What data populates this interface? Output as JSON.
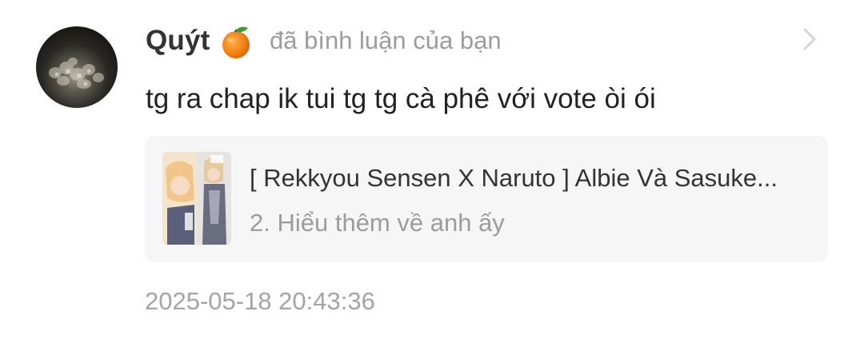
{
  "notification": {
    "username": "Quýt",
    "badge_icon": "orange-emoji-icon",
    "action_text": "đã bình luận của bạn",
    "comment": "tg ra chap ik tui tg tg cà phê với vote òi ói",
    "story": {
      "title": "[ Rekkyou Sensen X Naruto ] Albie Và Sasuke...",
      "chapter": "2. Hiểu thêm về anh ấy"
    },
    "timestamp": "2025-05-18 20:43:36"
  },
  "colors": {
    "username": "#333333",
    "secondary_text": "#9c9c9c",
    "card_background": "#f6f6f6",
    "orange": "#f08a1c"
  }
}
